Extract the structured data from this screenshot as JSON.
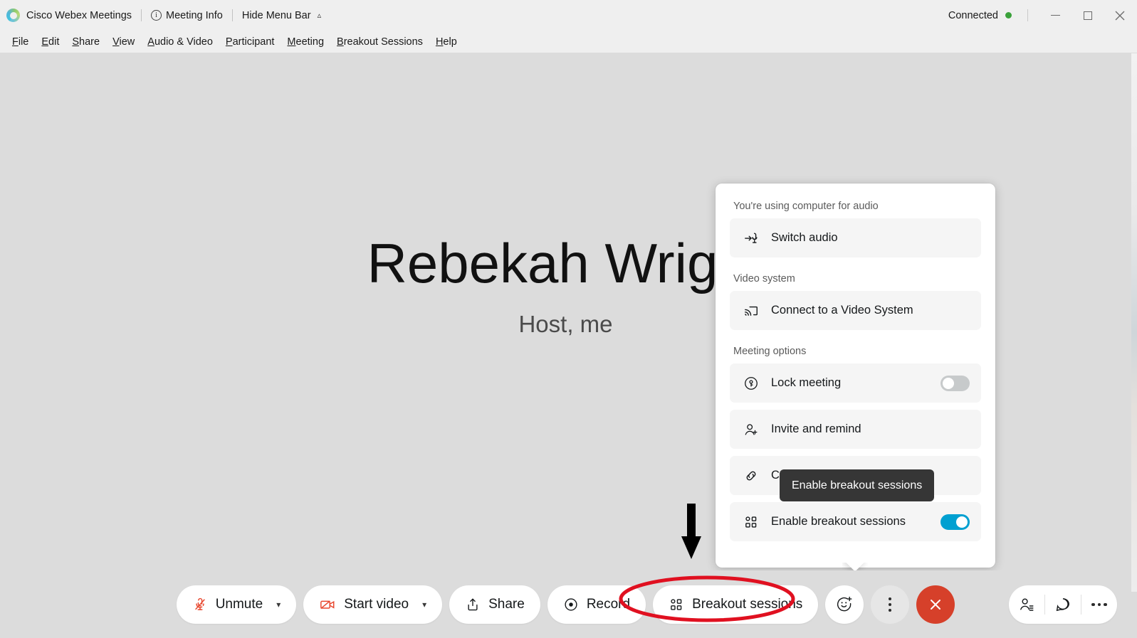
{
  "window": {
    "app_title": "Cisco Webex Meetings",
    "meeting_info_label": "Meeting Info",
    "hide_menu_bar_label": "Hide Menu Bar",
    "connection_status": "Connected",
    "status_color": "#3aa13a",
    "minimize_label": "Minimize",
    "maximize_label": "Maximize",
    "close_label": "Close"
  },
  "menubar": {
    "items": [
      {
        "label": "File",
        "accel": "F"
      },
      {
        "label": "Edit",
        "accel": "E"
      },
      {
        "label": "Share",
        "accel": "S"
      },
      {
        "label": "View",
        "accel": "V"
      },
      {
        "label": "Audio & Video",
        "accel": "A"
      },
      {
        "label": "Participant",
        "accel": "P"
      },
      {
        "label": "Meeting",
        "accel": "M"
      },
      {
        "label": "Breakout Sessions",
        "accel": "B"
      },
      {
        "label": "Help",
        "accel": "H"
      }
    ]
  },
  "stage": {
    "participant_name": "Rebekah Wright",
    "participant_role": "Host, me"
  },
  "panel": {
    "audio_section_label": "You're using computer for audio",
    "switch_audio_label": "Switch audio",
    "video_section_label": "Video system",
    "connect_video_label": "Connect to a Video System",
    "meeting_options_label": "Meeting options",
    "lock_meeting_label": "Lock meeting",
    "lock_meeting_toggle": "off",
    "invite_remind_label": "Invite and remind",
    "copy_link_label": "Copy meeting link",
    "enable_breakout_label": "Enable breakout sessions",
    "enable_breakout_toggle": "on",
    "toggle_on_color": "#00a0d1",
    "toggle_off_color": "#c7cacb"
  },
  "tooltip": {
    "text": "Enable breakout sessions",
    "background": "#363636"
  },
  "toolbar": {
    "unmute_label": "Unmute",
    "start_video_label": "Start video",
    "share_label": "Share",
    "record_label": "Record",
    "breakout_label": "Breakout sessions",
    "reactions_label": "Reactions",
    "more_options_label": "More options",
    "end_meeting_label": "End meeting",
    "participants_label": "Participants",
    "chat_label": "Chat",
    "more_label": "More",
    "end_button_color": "#d6402a",
    "mute_icon_color": "#e8472e"
  },
  "annotations": {
    "highlight_color": "#e01020",
    "arrow_color": "#000000",
    "highlight_target": "breakout-sessions-button",
    "arrow_target": "enable-breakout-sessions-row"
  }
}
